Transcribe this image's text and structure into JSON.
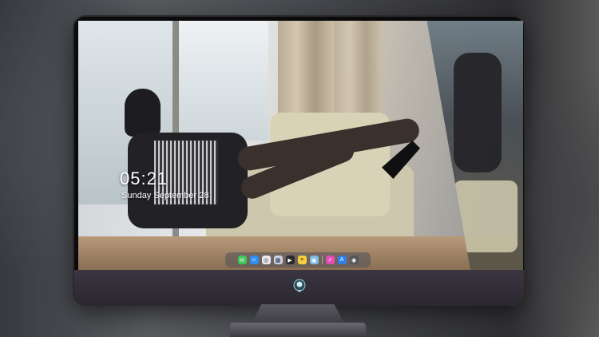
{
  "lockscreen": {
    "time": "05:21",
    "date": "Sunday September 28",
    "notice": ""
  },
  "dock": {
    "apps": [
      {
        "name": "messages-icon",
        "color": "#3fc55a",
        "glyph": "✉"
      },
      {
        "name": "finder-icon",
        "color": "#2f8ef0",
        "glyph": "☺"
      },
      {
        "name": "safari-icon",
        "color": "#e9e9ef",
        "glyph": "◎"
      },
      {
        "name": "photos-icon",
        "color": "#c8d0e6",
        "glyph": "▦"
      },
      {
        "name": "movie-icon",
        "color": "#2b2b2f",
        "glyph": "▶"
      },
      {
        "name": "notes-icon",
        "color": "#f4d03f",
        "glyph": "≡"
      },
      {
        "name": "preview-icon",
        "color": "#7bbbe6",
        "glyph": "▣"
      },
      {
        "name": "music-icon",
        "color": "#e44db5",
        "glyph": "♫"
      },
      {
        "name": "app-store-icon",
        "color": "#2d7ff0",
        "glyph": "A"
      },
      {
        "name": "camera-icon",
        "color": "#55565c",
        "glyph": "◉"
      }
    ]
  }
}
